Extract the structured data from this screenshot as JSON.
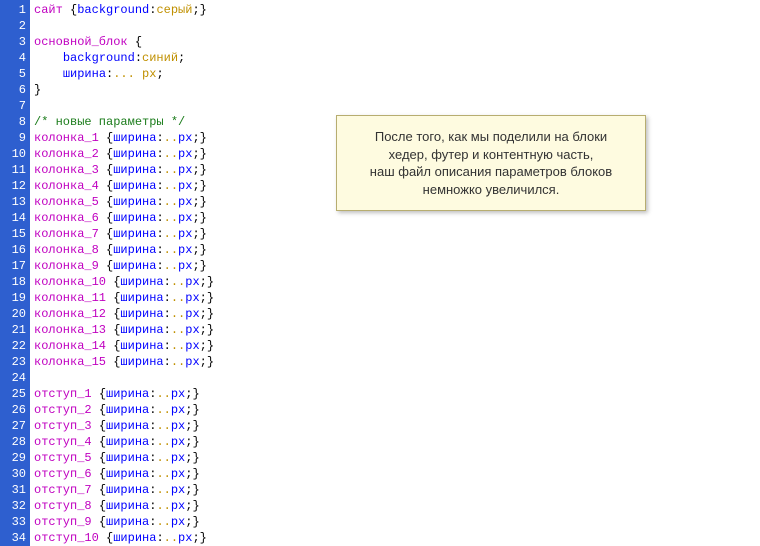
{
  "note": {
    "line1": "После того, как мы поделили на блоки",
    "line2": "хедер, футер и контентную часть,",
    "line3": "наш файл описания параметров блоков",
    "line4": "немножко увеличился."
  },
  "code_lines": [
    {
      "n": "1",
      "tokens": [
        {
          "c": "tk-sel",
          "t": "сайт "
        },
        {
          "c": "tk-punc",
          "t": "{"
        },
        {
          "c": "tk-prop",
          "t": "background"
        },
        {
          "c": "tk-punc",
          "t": ":"
        },
        {
          "c": "tk-val",
          "t": "серый"
        },
        {
          "c": "tk-punc",
          "t": ";}"
        }
      ]
    },
    {
      "n": "2",
      "tokens": []
    },
    {
      "n": "3",
      "tokens": [
        {
          "c": "tk-sel",
          "t": "основной_блок "
        },
        {
          "c": "tk-punc",
          "t": "{"
        }
      ]
    },
    {
      "n": "4",
      "tokens": [
        {
          "c": "tk-punc",
          "t": "    "
        },
        {
          "c": "tk-prop",
          "t": "background"
        },
        {
          "c": "tk-punc",
          "t": ":"
        },
        {
          "c": "tk-val",
          "t": "синий"
        },
        {
          "c": "tk-punc",
          "t": ";"
        }
      ]
    },
    {
      "n": "5",
      "tokens": [
        {
          "c": "tk-punc",
          "t": "    "
        },
        {
          "c": "tk-prop",
          "t": "ширина"
        },
        {
          "c": "tk-punc",
          "t": ":"
        },
        {
          "c": "tk-val",
          "t": "... px"
        },
        {
          "c": "tk-punc",
          "t": ";"
        }
      ]
    },
    {
      "n": "6",
      "tokens": [
        {
          "c": "tk-punc",
          "t": "}"
        }
      ]
    },
    {
      "n": "7",
      "tokens": []
    },
    {
      "n": "8",
      "tokens": [
        {
          "c": "tk-cmt",
          "t": "/* новые параметры */"
        }
      ]
    },
    {
      "n": "9",
      "tokens": [
        {
          "c": "tk-sel",
          "t": "колонка_1 "
        },
        {
          "c": "tk-punc",
          "t": "{"
        },
        {
          "c": "tk-prop",
          "t": "ширина"
        },
        {
          "c": "tk-punc",
          "t": ":"
        },
        {
          "c": "tk-val",
          "t": ".."
        },
        {
          "c": "tk-prop",
          "t": "px"
        },
        {
          "c": "tk-punc",
          "t": ";}"
        }
      ]
    },
    {
      "n": "10",
      "tokens": [
        {
          "c": "tk-sel",
          "t": "колонка_2 "
        },
        {
          "c": "tk-punc",
          "t": "{"
        },
        {
          "c": "tk-prop",
          "t": "ширина"
        },
        {
          "c": "tk-punc",
          "t": ":"
        },
        {
          "c": "tk-val",
          "t": ".."
        },
        {
          "c": "tk-prop",
          "t": "px"
        },
        {
          "c": "tk-punc",
          "t": ";}"
        }
      ]
    },
    {
      "n": "11",
      "tokens": [
        {
          "c": "tk-sel",
          "t": "колонка_3 "
        },
        {
          "c": "tk-punc",
          "t": "{"
        },
        {
          "c": "tk-prop",
          "t": "ширина"
        },
        {
          "c": "tk-punc",
          "t": ":"
        },
        {
          "c": "tk-val",
          "t": ".."
        },
        {
          "c": "tk-prop",
          "t": "px"
        },
        {
          "c": "tk-punc",
          "t": ";}"
        }
      ]
    },
    {
      "n": "12",
      "tokens": [
        {
          "c": "tk-sel",
          "t": "колонка_4 "
        },
        {
          "c": "tk-punc",
          "t": "{"
        },
        {
          "c": "tk-prop",
          "t": "ширина"
        },
        {
          "c": "tk-punc",
          "t": ":"
        },
        {
          "c": "tk-val",
          "t": ".."
        },
        {
          "c": "tk-prop",
          "t": "px"
        },
        {
          "c": "tk-punc",
          "t": ";}"
        }
      ]
    },
    {
      "n": "13",
      "tokens": [
        {
          "c": "tk-sel",
          "t": "колонка_5 "
        },
        {
          "c": "tk-punc",
          "t": "{"
        },
        {
          "c": "tk-prop",
          "t": "ширина"
        },
        {
          "c": "tk-punc",
          "t": ":"
        },
        {
          "c": "tk-val",
          "t": ".."
        },
        {
          "c": "tk-prop",
          "t": "px"
        },
        {
          "c": "tk-punc",
          "t": ";}"
        }
      ]
    },
    {
      "n": "14",
      "tokens": [
        {
          "c": "tk-sel",
          "t": "колонка_6 "
        },
        {
          "c": "tk-punc",
          "t": "{"
        },
        {
          "c": "tk-prop",
          "t": "ширина"
        },
        {
          "c": "tk-punc",
          "t": ":"
        },
        {
          "c": "tk-val",
          "t": ".."
        },
        {
          "c": "tk-prop",
          "t": "px"
        },
        {
          "c": "tk-punc",
          "t": ";}"
        }
      ]
    },
    {
      "n": "15",
      "tokens": [
        {
          "c": "tk-sel",
          "t": "колонка_7 "
        },
        {
          "c": "tk-punc",
          "t": "{"
        },
        {
          "c": "tk-prop",
          "t": "ширина"
        },
        {
          "c": "tk-punc",
          "t": ":"
        },
        {
          "c": "tk-val",
          "t": ".."
        },
        {
          "c": "tk-prop",
          "t": "px"
        },
        {
          "c": "tk-punc",
          "t": ";}"
        }
      ]
    },
    {
      "n": "16",
      "tokens": [
        {
          "c": "tk-sel",
          "t": "колонка_8 "
        },
        {
          "c": "tk-punc",
          "t": "{"
        },
        {
          "c": "tk-prop",
          "t": "ширина"
        },
        {
          "c": "tk-punc",
          "t": ":"
        },
        {
          "c": "tk-val",
          "t": ".."
        },
        {
          "c": "tk-prop",
          "t": "px"
        },
        {
          "c": "tk-punc",
          "t": ";}"
        }
      ]
    },
    {
      "n": "17",
      "tokens": [
        {
          "c": "tk-sel",
          "t": "колонка_9 "
        },
        {
          "c": "tk-punc",
          "t": "{"
        },
        {
          "c": "tk-prop",
          "t": "ширина"
        },
        {
          "c": "tk-punc",
          "t": ":"
        },
        {
          "c": "tk-val",
          "t": ".."
        },
        {
          "c": "tk-prop",
          "t": "px"
        },
        {
          "c": "tk-punc",
          "t": ";}"
        }
      ]
    },
    {
      "n": "18",
      "tokens": [
        {
          "c": "tk-sel",
          "t": "колонка_10 "
        },
        {
          "c": "tk-punc",
          "t": "{"
        },
        {
          "c": "tk-prop",
          "t": "ширина"
        },
        {
          "c": "tk-punc",
          "t": ":"
        },
        {
          "c": "tk-val",
          "t": ".."
        },
        {
          "c": "tk-prop",
          "t": "px"
        },
        {
          "c": "tk-punc",
          "t": ";}"
        }
      ]
    },
    {
      "n": "19",
      "tokens": [
        {
          "c": "tk-sel",
          "t": "колонка_11 "
        },
        {
          "c": "tk-punc",
          "t": "{"
        },
        {
          "c": "tk-prop",
          "t": "ширина"
        },
        {
          "c": "tk-punc",
          "t": ":"
        },
        {
          "c": "tk-val",
          "t": ".."
        },
        {
          "c": "tk-prop",
          "t": "px"
        },
        {
          "c": "tk-punc",
          "t": ";}"
        }
      ]
    },
    {
      "n": "20",
      "tokens": [
        {
          "c": "tk-sel",
          "t": "колонка_12 "
        },
        {
          "c": "tk-punc",
          "t": "{"
        },
        {
          "c": "tk-prop",
          "t": "ширина"
        },
        {
          "c": "tk-punc",
          "t": ":"
        },
        {
          "c": "tk-val",
          "t": ".."
        },
        {
          "c": "tk-prop",
          "t": "px"
        },
        {
          "c": "tk-punc",
          "t": ";}"
        }
      ]
    },
    {
      "n": "21",
      "tokens": [
        {
          "c": "tk-sel",
          "t": "колонка_13 "
        },
        {
          "c": "tk-punc",
          "t": "{"
        },
        {
          "c": "tk-prop",
          "t": "ширина"
        },
        {
          "c": "tk-punc",
          "t": ":"
        },
        {
          "c": "tk-val",
          "t": ".."
        },
        {
          "c": "tk-prop",
          "t": "px"
        },
        {
          "c": "tk-punc",
          "t": ";}"
        }
      ]
    },
    {
      "n": "22",
      "tokens": [
        {
          "c": "tk-sel",
          "t": "колонка_14 "
        },
        {
          "c": "tk-punc",
          "t": "{"
        },
        {
          "c": "tk-prop",
          "t": "ширина"
        },
        {
          "c": "tk-punc",
          "t": ":"
        },
        {
          "c": "tk-val",
          "t": ".."
        },
        {
          "c": "tk-prop",
          "t": "px"
        },
        {
          "c": "tk-punc",
          "t": ";}"
        }
      ]
    },
    {
      "n": "23",
      "tokens": [
        {
          "c": "tk-sel",
          "t": "колонка_15 "
        },
        {
          "c": "tk-punc",
          "t": "{"
        },
        {
          "c": "tk-prop",
          "t": "ширина"
        },
        {
          "c": "tk-punc",
          "t": ":"
        },
        {
          "c": "tk-val",
          "t": ".."
        },
        {
          "c": "tk-prop",
          "t": "px"
        },
        {
          "c": "tk-punc",
          "t": ";}"
        }
      ]
    },
    {
      "n": "24",
      "tokens": []
    },
    {
      "n": "25",
      "tokens": [
        {
          "c": "tk-sel",
          "t": "отступ_1 "
        },
        {
          "c": "tk-punc",
          "t": "{"
        },
        {
          "c": "tk-prop",
          "t": "ширина"
        },
        {
          "c": "tk-punc",
          "t": ":"
        },
        {
          "c": "tk-val",
          "t": ".."
        },
        {
          "c": "tk-prop",
          "t": "px"
        },
        {
          "c": "tk-punc",
          "t": ";}"
        }
      ]
    },
    {
      "n": "26",
      "tokens": [
        {
          "c": "tk-sel",
          "t": "отступ_2 "
        },
        {
          "c": "tk-punc",
          "t": "{"
        },
        {
          "c": "tk-prop",
          "t": "ширина"
        },
        {
          "c": "tk-punc",
          "t": ":"
        },
        {
          "c": "tk-val",
          "t": ".."
        },
        {
          "c": "tk-prop",
          "t": "px"
        },
        {
          "c": "tk-punc",
          "t": ";}"
        }
      ]
    },
    {
      "n": "27",
      "tokens": [
        {
          "c": "tk-sel",
          "t": "отступ_3 "
        },
        {
          "c": "tk-punc",
          "t": "{"
        },
        {
          "c": "tk-prop",
          "t": "ширина"
        },
        {
          "c": "tk-punc",
          "t": ":"
        },
        {
          "c": "tk-val",
          "t": ".."
        },
        {
          "c": "tk-prop",
          "t": "px"
        },
        {
          "c": "tk-punc",
          "t": ";}"
        }
      ]
    },
    {
      "n": "28",
      "tokens": [
        {
          "c": "tk-sel",
          "t": "отступ_4 "
        },
        {
          "c": "tk-punc",
          "t": "{"
        },
        {
          "c": "tk-prop",
          "t": "ширина"
        },
        {
          "c": "tk-punc",
          "t": ":"
        },
        {
          "c": "tk-val",
          "t": ".."
        },
        {
          "c": "tk-prop",
          "t": "px"
        },
        {
          "c": "tk-punc",
          "t": ";}"
        }
      ]
    },
    {
      "n": "29",
      "tokens": [
        {
          "c": "tk-sel",
          "t": "отступ_5 "
        },
        {
          "c": "tk-punc",
          "t": "{"
        },
        {
          "c": "tk-prop",
          "t": "ширина"
        },
        {
          "c": "tk-punc",
          "t": ":"
        },
        {
          "c": "tk-val",
          "t": ".."
        },
        {
          "c": "tk-prop",
          "t": "px"
        },
        {
          "c": "tk-punc",
          "t": ";}"
        }
      ]
    },
    {
      "n": "30",
      "tokens": [
        {
          "c": "tk-sel",
          "t": "отступ_6 "
        },
        {
          "c": "tk-punc",
          "t": "{"
        },
        {
          "c": "tk-prop",
          "t": "ширина"
        },
        {
          "c": "tk-punc",
          "t": ":"
        },
        {
          "c": "tk-val",
          "t": ".."
        },
        {
          "c": "tk-prop",
          "t": "px"
        },
        {
          "c": "tk-punc",
          "t": ";}"
        }
      ]
    },
    {
      "n": "31",
      "tokens": [
        {
          "c": "tk-sel",
          "t": "отступ_7 "
        },
        {
          "c": "tk-punc",
          "t": "{"
        },
        {
          "c": "tk-prop",
          "t": "ширина"
        },
        {
          "c": "tk-punc",
          "t": ":"
        },
        {
          "c": "tk-val",
          "t": ".."
        },
        {
          "c": "tk-prop",
          "t": "px"
        },
        {
          "c": "tk-punc",
          "t": ";}"
        }
      ]
    },
    {
      "n": "32",
      "tokens": [
        {
          "c": "tk-sel",
          "t": "отступ_8 "
        },
        {
          "c": "tk-punc",
          "t": "{"
        },
        {
          "c": "tk-prop",
          "t": "ширина"
        },
        {
          "c": "tk-punc",
          "t": ":"
        },
        {
          "c": "tk-val",
          "t": ".."
        },
        {
          "c": "tk-prop",
          "t": "px"
        },
        {
          "c": "tk-punc",
          "t": ";}"
        }
      ]
    },
    {
      "n": "33",
      "tokens": [
        {
          "c": "tk-sel",
          "t": "отступ_9 "
        },
        {
          "c": "tk-punc",
          "t": "{"
        },
        {
          "c": "tk-prop",
          "t": "ширина"
        },
        {
          "c": "tk-punc",
          "t": ":"
        },
        {
          "c": "tk-val",
          "t": ".."
        },
        {
          "c": "tk-prop",
          "t": "px"
        },
        {
          "c": "tk-punc",
          "t": ";}"
        }
      ]
    },
    {
      "n": "34",
      "tokens": [
        {
          "c": "tk-sel",
          "t": "отступ_10 "
        },
        {
          "c": "tk-punc",
          "t": "{"
        },
        {
          "c": "tk-prop",
          "t": "ширина"
        },
        {
          "c": "tk-punc",
          "t": ":"
        },
        {
          "c": "tk-val",
          "t": ".."
        },
        {
          "c": "tk-prop",
          "t": "px"
        },
        {
          "c": "tk-punc",
          "t": ";}"
        }
      ]
    }
  ]
}
